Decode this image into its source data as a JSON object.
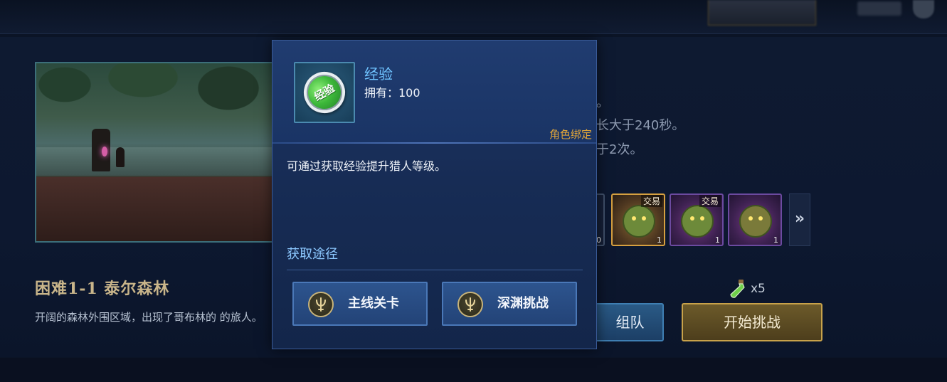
{
  "stage": {
    "title": "困难1-1  泰尔森林",
    "description": "开阔的森林外围区域，出现了哥布林的 的旅人。"
  },
  "rules": [
    "。",
    "长大于240秒。",
    "于2次。"
  ],
  "rewards": [
    {
      "tag": "",
      "count": "0",
      "icon": "reward-partial"
    },
    {
      "tag": "交易",
      "count": "1",
      "icon": "goblin-green-icon"
    },
    {
      "tag": "交易",
      "count": "1",
      "icon": "goblin-purple-icon"
    },
    {
      "tag": "",
      "count": "1",
      "icon": "goblin-helmet-icon"
    }
  ],
  "more_symbol": "»",
  "stamina": {
    "count": "x5",
    "icon": "potion-icon"
  },
  "buttons": {
    "team": "组队",
    "start": "开始挑战"
  },
  "popup": {
    "item_name": "经验",
    "item_icon_text": "经验",
    "owned": "拥有：100",
    "bind": "角色绑定",
    "description": "可通过获取经验提升猎人等级。",
    "source_title": "获取途径",
    "sources": [
      {
        "label": "主线关卡",
        "icon": "trident-emblem-icon"
      },
      {
        "label": "深渊挑战",
        "icon": "trident-emblem-icon"
      }
    ]
  },
  "colors": {
    "accent_blue": "#6fc3ff",
    "bind_orange": "#e0a53a",
    "start_gold": "#c8a24a"
  }
}
